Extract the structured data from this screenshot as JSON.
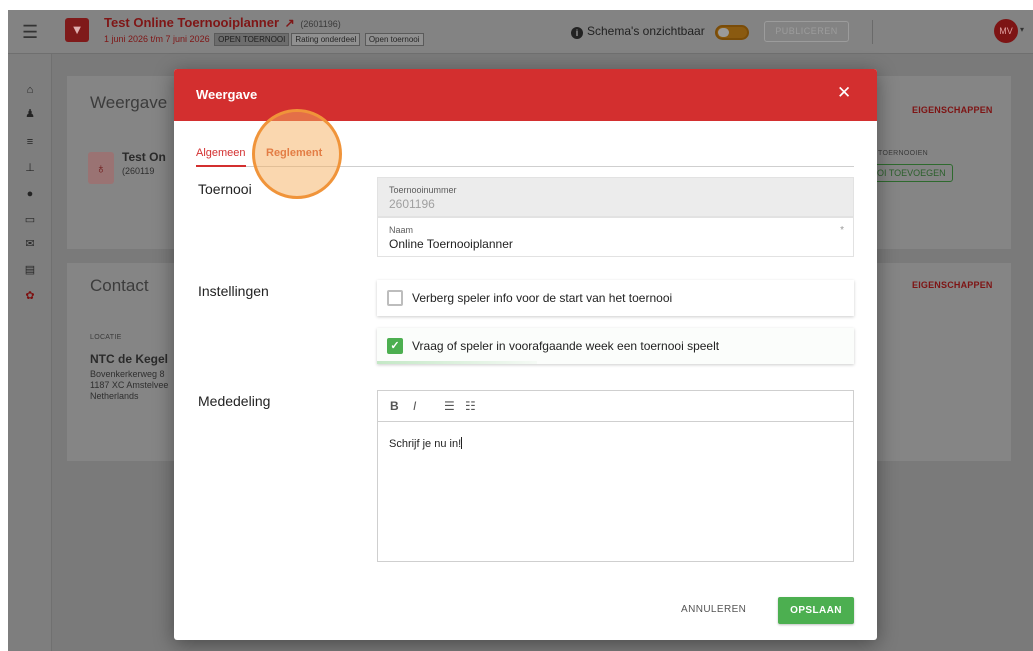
{
  "banner_text": "",
  "topbar": {
    "tournament_title": "Test Online Toernooiplanner",
    "tournament_id": "(2601196)",
    "dates": "1 juni 2026 t/m 7 juni 2026",
    "tags": [
      "OPEN TOERNOOI",
      "Rating onderdeel",
      "Open toernooi"
    ],
    "schema_label": "Schema's onzichtbaar",
    "publish_label": "PUBLICEREN",
    "avatar_initials": "MV"
  },
  "background": {
    "card1_title": "Weergave",
    "card1_link": "EIGENSCHAPPEN",
    "card1_name": "Test On",
    "card1_id": "(260119",
    "card1_right_label": "TOERNOOIEN",
    "card1_right_button": "OI TOEVOEGEN",
    "card2_title": "Contact",
    "card2_link": "EIGENSCHAPPEN",
    "location_label": "LOCATIE",
    "location_name": "NTC de Kegel",
    "location_address": "Bovenkerkerweg 8\n1187 XC Amstelvee\nNetherlands"
  },
  "modal": {
    "title": "Weergave",
    "tabs": [
      "Algemeen",
      "Reglement"
    ],
    "sections": {
      "toernooi": "Toernooi",
      "instellingen": "Instellingen",
      "mededeling": "Mededeling"
    },
    "fields": {
      "number_label": "Toernooinummer",
      "number_value": "2601196",
      "name_label": "Naam",
      "name_value": "Online Toernooiplanner",
      "required_mark": "*"
    },
    "checkboxes": [
      {
        "label": "Verberg speler info voor de start van het toernooi",
        "checked": false
      },
      {
        "label": "Vraag of speler in voorafgaande week een toernooi speelt",
        "checked": true
      }
    ],
    "editor": {
      "toolbar": [
        "B",
        "I",
        "☰",
        "☷"
      ],
      "content": "Schrijf je nu in!"
    },
    "cancel_label": "ANNULEREN",
    "save_label": "OPSLAAN"
  },
  "colors": {
    "header_red": "#d32f2f",
    "save_green": "#4caf50",
    "highlight_orange": "#f0943a"
  }
}
